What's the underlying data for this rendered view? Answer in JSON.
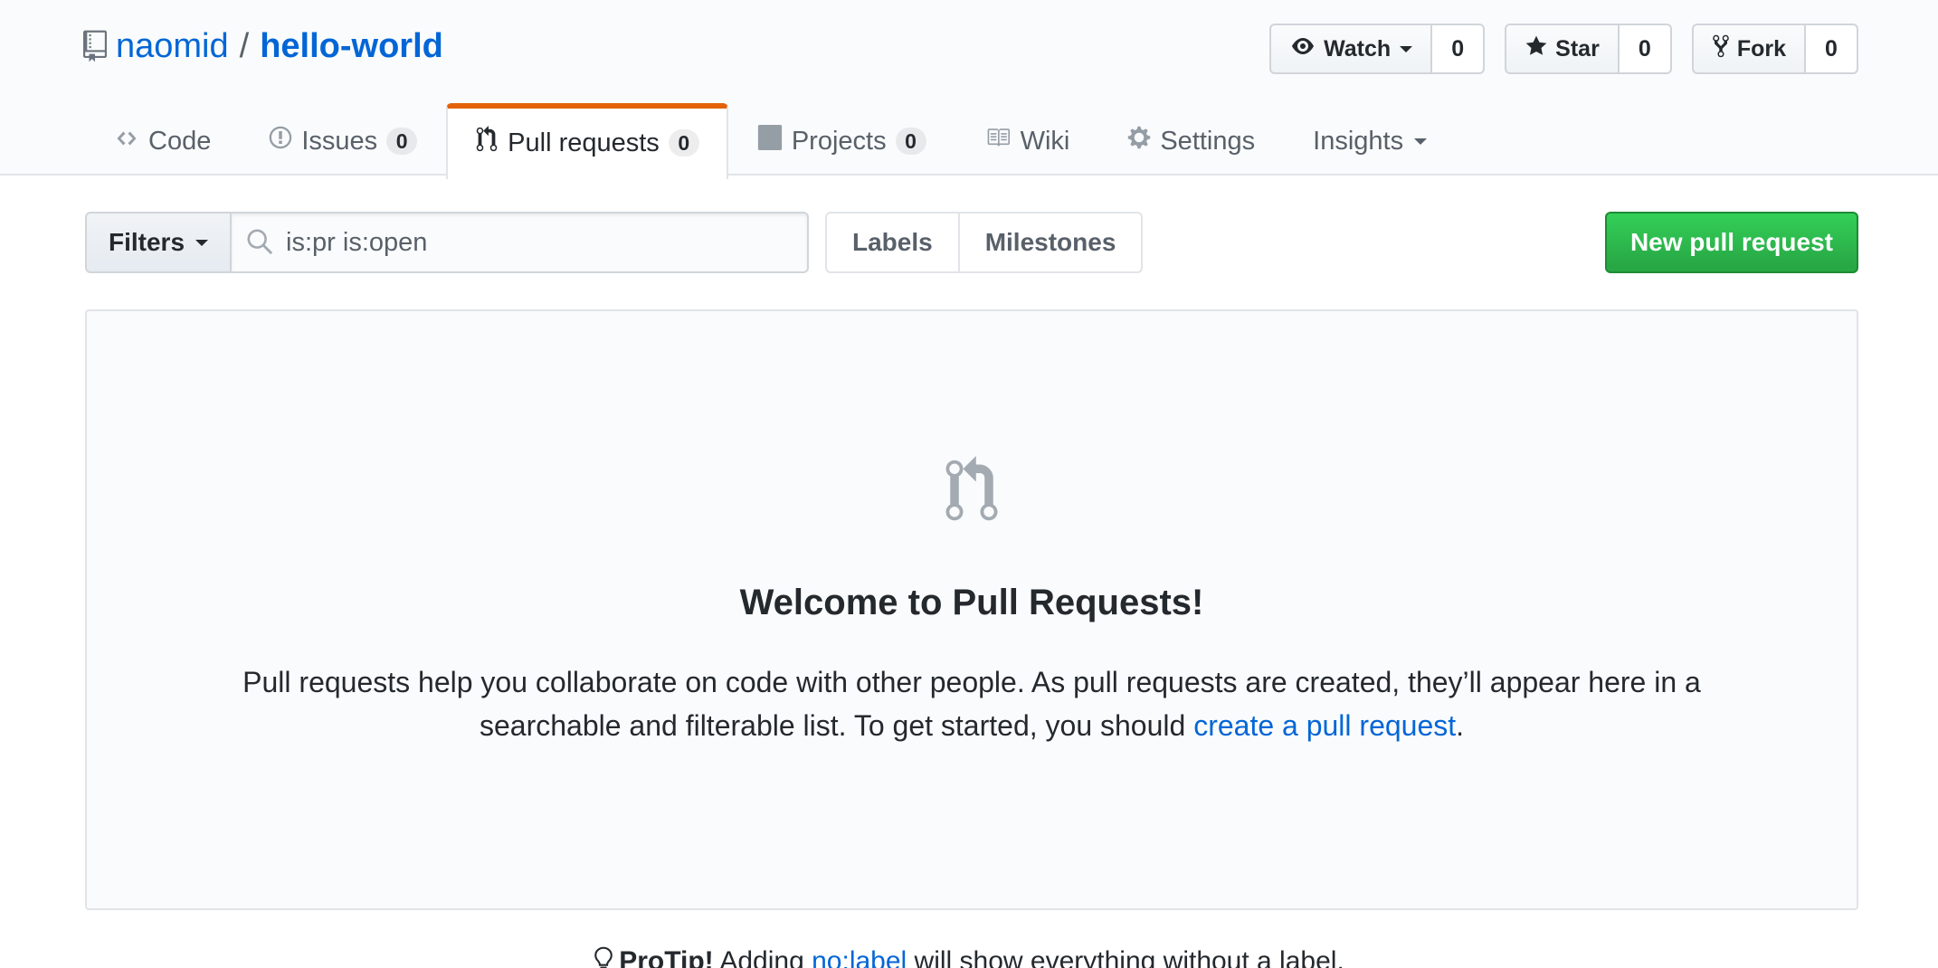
{
  "repo": {
    "owner": "naomid",
    "separator": "/",
    "name": "hello-world"
  },
  "actions": {
    "watch": {
      "label": "Watch",
      "count": "0"
    },
    "star": {
      "label": "Star",
      "count": "0"
    },
    "fork": {
      "label": "Fork",
      "count": "0"
    }
  },
  "tabs": [
    {
      "label": "Code",
      "icon": "code-icon"
    },
    {
      "label": "Issues",
      "count": "0",
      "icon": "issue-icon"
    },
    {
      "label": "Pull requests",
      "count": "0",
      "icon": "pull-request-icon",
      "selected": true
    },
    {
      "label": "Projects",
      "count": "0",
      "icon": "project-icon"
    },
    {
      "label": "Wiki",
      "icon": "book-icon"
    },
    {
      "label": "Settings",
      "icon": "gear-icon"
    },
    {
      "label": "Insights",
      "icon": "chevron-down-icon"
    }
  ],
  "subnav": {
    "filters_label": "Filters",
    "search_value": "is:pr is:open",
    "labels_label": "Labels",
    "milestones_label": "Milestones",
    "new_pr_label": "New pull request"
  },
  "blankslate": {
    "title": "Welcome to Pull Requests!",
    "text_before": "Pull requests help you collaborate on code with other people. As pull requests are created, they’ll appear here in a searchable and filterable list. To get started, you should ",
    "link": "create a pull request",
    "text_after": "."
  },
  "protip": {
    "prefix": "ProTip!",
    "text_before": " Adding ",
    "link": "no:label",
    "text_after": " will show everything without a label."
  },
  "colors": {
    "link": "#0366d6",
    "selected_tab_accent": "#e36209",
    "primary_button": "#28a745"
  }
}
